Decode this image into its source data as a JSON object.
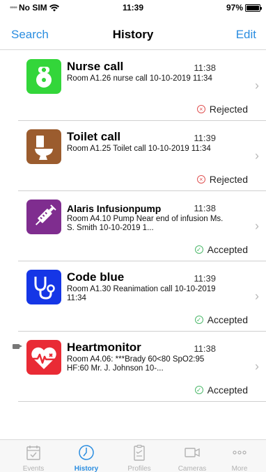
{
  "status_bar": {
    "carrier": "No SIM",
    "time": "11:39",
    "battery": "97%"
  },
  "nav": {
    "left_label": "Search",
    "title": "History",
    "right_label": "Edit"
  },
  "items": [
    {
      "icon": "nurse-call-icon",
      "icon_color": "#33d63a",
      "title": "Nurse call",
      "time": "11:38",
      "desc": "Room A1.26 nurse call 10-10-2019 11:34",
      "status": "Rejected"
    },
    {
      "icon": "toilet-icon",
      "icon_color": "#9b5c2e",
      "title": "Toilet call",
      "time": "11:39",
      "desc": "Room A1.25 Toilet call 10-10-2019 11:34",
      "status": "Rejected"
    },
    {
      "icon": "syringe-icon",
      "icon_color": "#7f2d8f",
      "title": "Alaris Infusionpump",
      "time": "11:38",
      "desc": "Room A4.10 Pump Near end of infusion Ms. S. Smith 10-10-2019 1...",
      "status": "Accepted"
    },
    {
      "icon": "stethoscope-icon",
      "icon_color": "#1536e6",
      "title": "Code blue",
      "time": "11:39",
      "desc": "Room A1.30 Reanimation call 10-10-2019 11:34",
      "status": "Accepted"
    },
    {
      "icon": "heart-monitor-icon",
      "icon_color": "#e92b35",
      "title": "Heartmonitor",
      "time": "11:38",
      "desc": "Room A4.06: ***Brady 60<80 SpO2:95 HF:60 Mr. J. Johnson 10-...",
      "status": "Accepted"
    }
  ],
  "tabs": [
    {
      "label": "Events",
      "icon": "events-icon",
      "active": false
    },
    {
      "label": "History",
      "icon": "history-icon",
      "active": true
    },
    {
      "label": "Profiles",
      "icon": "profiles-icon",
      "active": false
    },
    {
      "label": "Cameras",
      "icon": "cameras-icon",
      "active": false
    },
    {
      "label": "More",
      "icon": "more-icon",
      "active": false
    }
  ],
  "colors": {
    "accent": "#2a8de0",
    "rejected": "#e05252",
    "accepted": "#4cb86a"
  }
}
